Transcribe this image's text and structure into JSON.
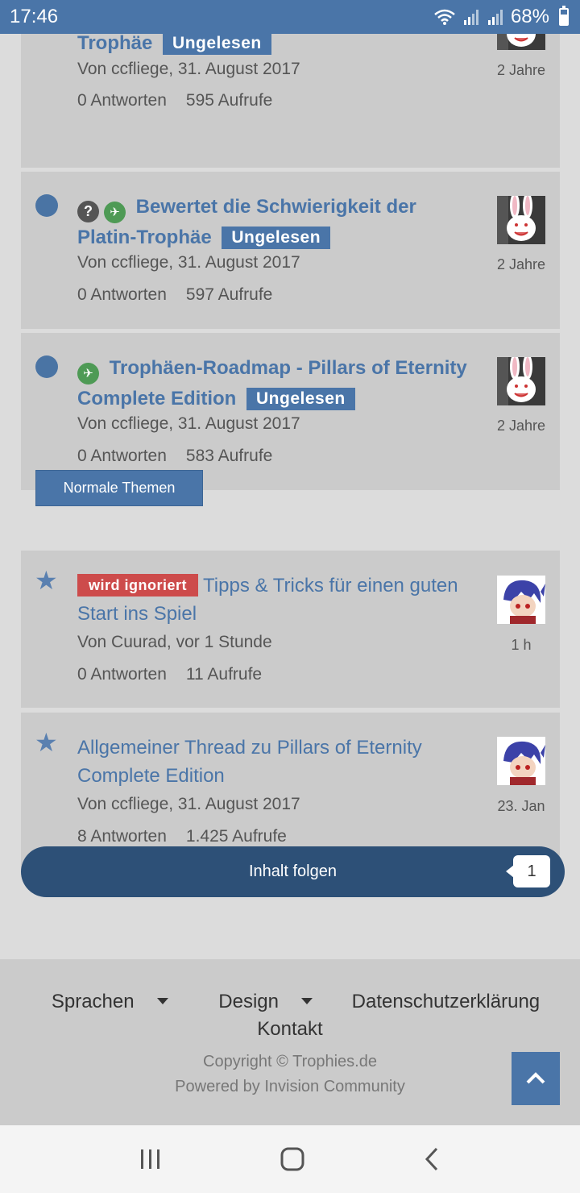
{
  "status_bar": {
    "time": "17:46",
    "battery": "68%",
    "battery_level": 0.68
  },
  "pinned_topics": [
    {
      "title": "Bewertet den Zeitaufwand der Platin-Trophäe",
      "badge": "Ungelesen",
      "author": "Von ccfliege, 31. August 2017",
      "replies": "0 Antworten",
      "views": "595 Aufrufe",
      "age": "2 Jahre"
    },
    {
      "title": "Bewertet die Schwierigkeit der Platin-Trophäe",
      "badge": "Ungelesen",
      "author": "Von ccfliege, 31. August 2017",
      "replies": "0 Antworten",
      "views": "597 Aufrufe",
      "age": "2 Jahre"
    },
    {
      "title": "Trophäen-Roadmap - Pillars of Eternity Complete Edition",
      "badge": "Ungelesen",
      "author": "Von ccfliege, 31. August 2017",
      "replies": "0 Antworten",
      "views": "583 Aufrufe",
      "age": "2 Jahre"
    }
  ],
  "section_label": "Normale Themen",
  "normal_topics": [
    {
      "badge": "wird ignoriert",
      "title": "Tipps & Tricks für einen guten Start ins Spiel",
      "author": "Von Cuurad, vor 1 Stunde",
      "replies": "0 Antworten",
      "views": "11 Aufrufe",
      "age": "1 h"
    },
    {
      "title": "Allgemeiner Thread zu Pillars of Eternity Complete Edition",
      "author": "Von ccfliege, 31. August 2017",
      "replies": "8 Antworten",
      "views": "1.425 Aufrufe",
      "age": "23. Jan"
    }
  ],
  "follow": {
    "label": "Inhalt folgen",
    "count": "1"
  },
  "footer": {
    "languages": "Sprachen",
    "design": "Design",
    "privacy": "Datenschutzerklärung",
    "contact": "Kontakt",
    "copyright": "Copyright © Trophies.de",
    "powered": "Powered by Invision Community"
  },
  "colors": {
    "accent": "#4a75a8",
    "dark_accent": "#2d5077",
    "ignored": "#cd4b4b",
    "pinned": "#4e9a55"
  }
}
